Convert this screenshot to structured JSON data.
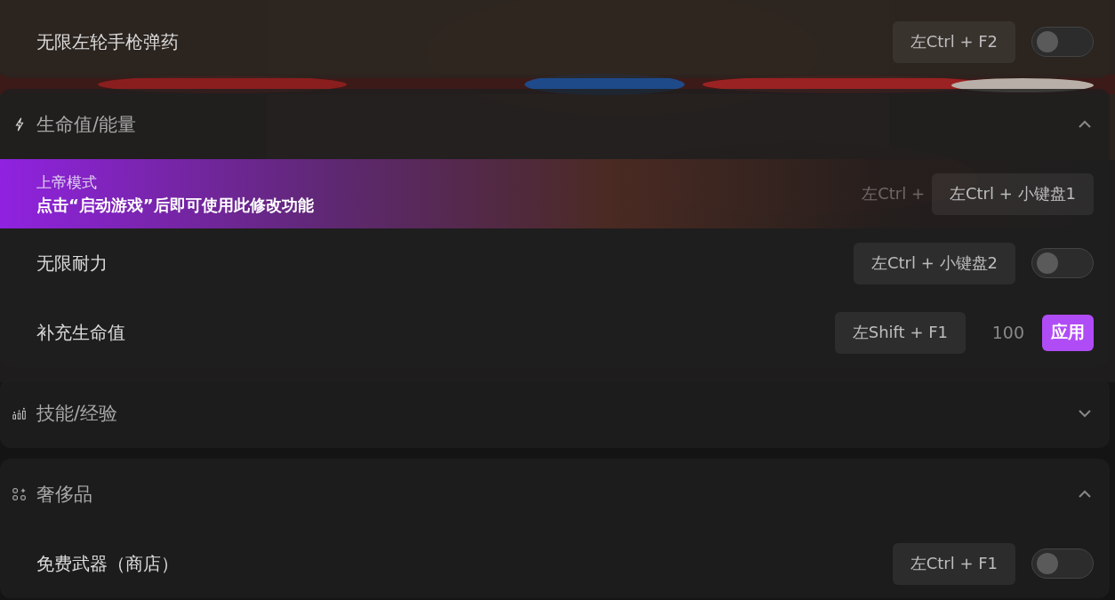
{
  "sections": [
    {
      "items": [
        {
          "kind": "toggle",
          "label": "无限左轮手枪弹药",
          "hotkey": "左Ctrl + F2",
          "on": false
        }
      ]
    },
    {
      "title": "生命值/能量",
      "expanded": true,
      "items": [
        {
          "kind": "hint",
          "label": "上帝模式",
          "hint": "点击“启动游戏”后即可使用此修改功能",
          "faded_hotkey": "左Ctrl +",
          "hotkey": "左Ctrl + 小键盘1"
        },
        {
          "kind": "toggle",
          "label": "无限耐力",
          "hotkey": "左Ctrl + 小键盘2",
          "on": false
        },
        {
          "kind": "apply",
          "label": "补充生命值",
          "hotkey": "左Shift + F1",
          "value": "100",
          "button": "应用"
        }
      ]
    },
    {
      "title": "技能/经验",
      "expanded": false
    },
    {
      "title": "奢侈品",
      "expanded": true,
      "items": [
        {
          "kind": "toggle",
          "label": "免费武器（商店）",
          "hotkey": "左Ctrl + F1",
          "on": false
        }
      ]
    }
  ]
}
